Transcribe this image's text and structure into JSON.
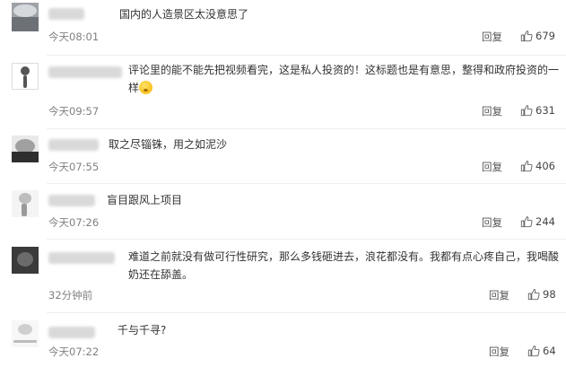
{
  "comments": [
    {
      "text": "国内的人造景区太没意思了",
      "time": "今天08:01",
      "reply_label": "回复",
      "likes": "679"
    },
    {
      "text": "评论里的能不能先把视频看完，这是私人投资的！这标题也是有意思，整得和政府投资的一样",
      "time": "今天09:57",
      "reply_label": "回复",
      "likes": "631",
      "emoji_icon": "astonished-face"
    },
    {
      "text": "取之尽锱铢，用之如泥沙",
      "time": "今天07:55",
      "reply_label": "回复",
      "likes": "406"
    },
    {
      "text": "盲目跟风上项目",
      "time": "今天07:26",
      "reply_label": "回复",
      "likes": "244"
    },
    {
      "text": "难道之前就没有做可行性研究，那么多钱砸进去，浪花都没有。我都有点心疼自己，我喝酸奶还在舔盖。",
      "time": "32分钟前",
      "reply_label": "回复",
      "likes": "98"
    },
    {
      "text": "千与千寻?",
      "time": "今天07:22",
      "reply_label": "回复",
      "likes": "64"
    }
  ],
  "colors": {
    "text": "#333333",
    "meta": "#808080",
    "divider": "#eeeeee"
  }
}
